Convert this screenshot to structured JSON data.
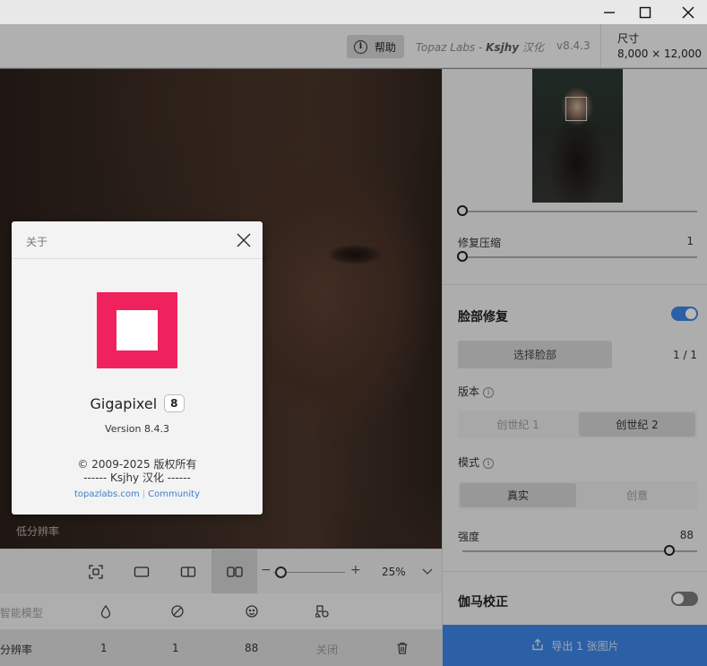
{
  "window": {
    "controls": [
      "minimize",
      "maximize",
      "close"
    ]
  },
  "header": {
    "help_label": "帮助",
    "brand_prefix": "Topaz Labs - ",
    "brand_author": "Ksjhy",
    "brand_suffix": " 汉化",
    "version": "v8.4.3",
    "size_label": "尺寸",
    "size_value": "8,000 × 12,000"
  },
  "viewport": {
    "lowres_label": "低分辨率",
    "zoom_value": "25%",
    "zoom_minus": "−",
    "zoom_plus": "+",
    "active_view": "side-by-side"
  },
  "model_table": {
    "header": {
      "model_label": "AI智能模型"
    },
    "row": {
      "name": "低分辨率",
      "col1": "1",
      "col2": "1",
      "col3": "88",
      "col4": "关闭"
    }
  },
  "sidebar": {
    "fix_compression_label": "修复压缩",
    "fix_compression_value": "1",
    "face_recovery_title": "脸部修复",
    "face_recovery_on": true,
    "select_face_label": "选择脸部",
    "face_count": "1 / 1",
    "version_label": "版本",
    "version_options": [
      {
        "label": "创世纪 1",
        "selected": false
      },
      {
        "label": "创世纪 2",
        "selected": true
      }
    ],
    "mode_label": "模式",
    "mode_options": [
      {
        "label": "真实",
        "selected": true
      },
      {
        "label": "创意",
        "selected": false
      }
    ],
    "strength_label": "强度",
    "strength_value": "88",
    "gamma_title": "伽马校正",
    "gamma_on": false,
    "export_label": "导出 1 张图片"
  },
  "about_dialog": {
    "title": "关于",
    "product_name": "Gigapixel",
    "product_badge": "8",
    "version_text": "Version 8.4.3",
    "copyright": "© 2009-2025 版权所有",
    "credit": "------ Ksjhy 汉化 ------",
    "link_site": "topazlabs.com",
    "link_community": "Community"
  },
  "colors": {
    "accent_blue": "#3d86e6",
    "logo_pink": "#f0225d",
    "toggle_on": "#3d86e6",
    "toggle_off": "#7a7a7a"
  }
}
